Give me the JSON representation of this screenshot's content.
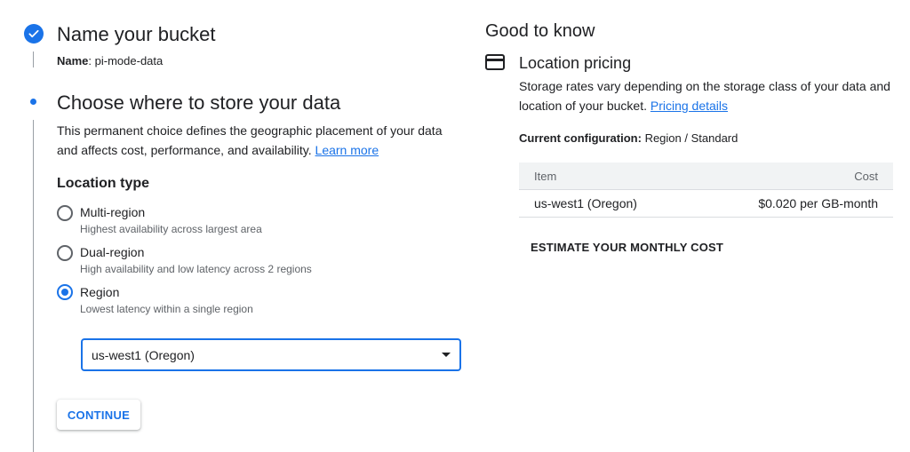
{
  "step1": {
    "title": "Name your bucket",
    "name_label": "Name",
    "name_value": "pi-mode-data"
  },
  "step2": {
    "title": "Choose where to store your data",
    "description": "This permanent choice defines the geographic placement of your data and affects cost, performance, and availability.",
    "learn_more": "Learn more",
    "location_type_heading": "Location type",
    "options": [
      {
        "label": "Multi-region",
        "description": "Highest availability across largest area",
        "selected": false
      },
      {
        "label": "Dual-region",
        "description": "High availability and low latency across 2 regions",
        "selected": false
      },
      {
        "label": "Region",
        "description": "Lowest latency within a single region",
        "selected": true
      }
    ],
    "region_select_value": "us-west1 (Oregon)",
    "continue_label": "CONTINUE"
  },
  "good_to_know": {
    "heading": "Good to know",
    "section_title": "Location pricing",
    "description": "Storage rates vary depending on the storage class of your data and location of your bucket.",
    "pricing_link": "Pricing details",
    "config_label": "Current configuration:",
    "config_value": "Region / Standard",
    "table": {
      "headers": [
        "Item",
        "Cost"
      ],
      "rows": [
        [
          "us-west1 (Oregon)",
          "$0.020 per GB-month"
        ]
      ]
    },
    "estimate_label": "ESTIMATE YOUR MONTHLY COST"
  },
  "colors": {
    "accent": "#1a73e8",
    "text": "#202124",
    "muted": "#5f6368"
  },
  "icons": {
    "step_complete": "check-circle-icon",
    "step_current": "dot-icon",
    "pricing": "credit-card-icon",
    "dropdown": "caret-down-icon"
  }
}
